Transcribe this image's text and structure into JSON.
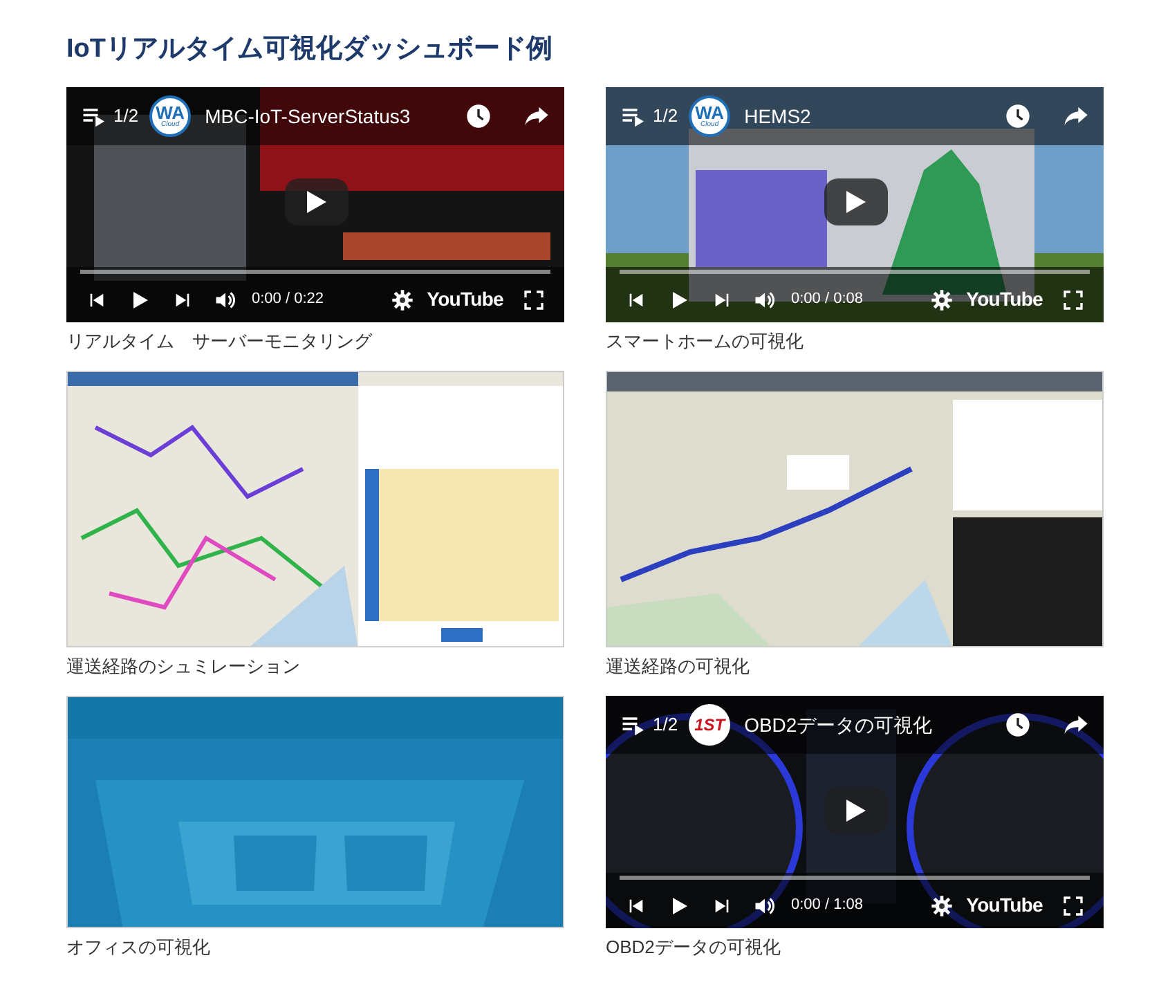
{
  "title": "IoTリアルタイム可視化ダッシュボード例",
  "rows": [
    {
      "items": [
        {
          "kind": "video",
          "caption": "リアルタイム　サーバーモニタリング",
          "player": {
            "counter": "1/2",
            "logo": {
              "kind": "wa",
              "text": "WA",
              "subtext": "Cloud"
            },
            "title": "MBC-IoT-ServerStatus3",
            "progress": {
              "level": 0
            },
            "time": "0:00 / 0:22",
            "brand": "YouTube"
          }
        },
        {
          "kind": "video",
          "caption": "スマートホームの可視化",
          "player": {
            "counter": "1/2",
            "logo": {
              "kind": "wa",
              "text": "WA",
              "subtext": "Cloud"
            },
            "title": "HEMS2",
            "progress": {
              "level": 0
            },
            "time": "0:00 / 0:08",
            "brand": "YouTube"
          }
        }
      ]
    },
    {
      "items": [
        {
          "caption": "運送経路のシュミレーション"
        },
        {
          "caption": "運送経路の可視化"
        }
      ]
    },
    {
      "items": [
        {
          "caption": "オフィスの可視化"
        },
        {
          "kind": "video",
          "caption": "OBD2データの可視化",
          "player": {
            "counter": "1/2",
            "logo": {
              "kind": "first",
              "text": "1ST"
            },
            "title": "OBD2データの可視化",
            "progress": {
              "level": 0
            },
            "time": "0:00 / 1:08",
            "brand": "YouTube"
          }
        }
      ]
    }
  ]
}
